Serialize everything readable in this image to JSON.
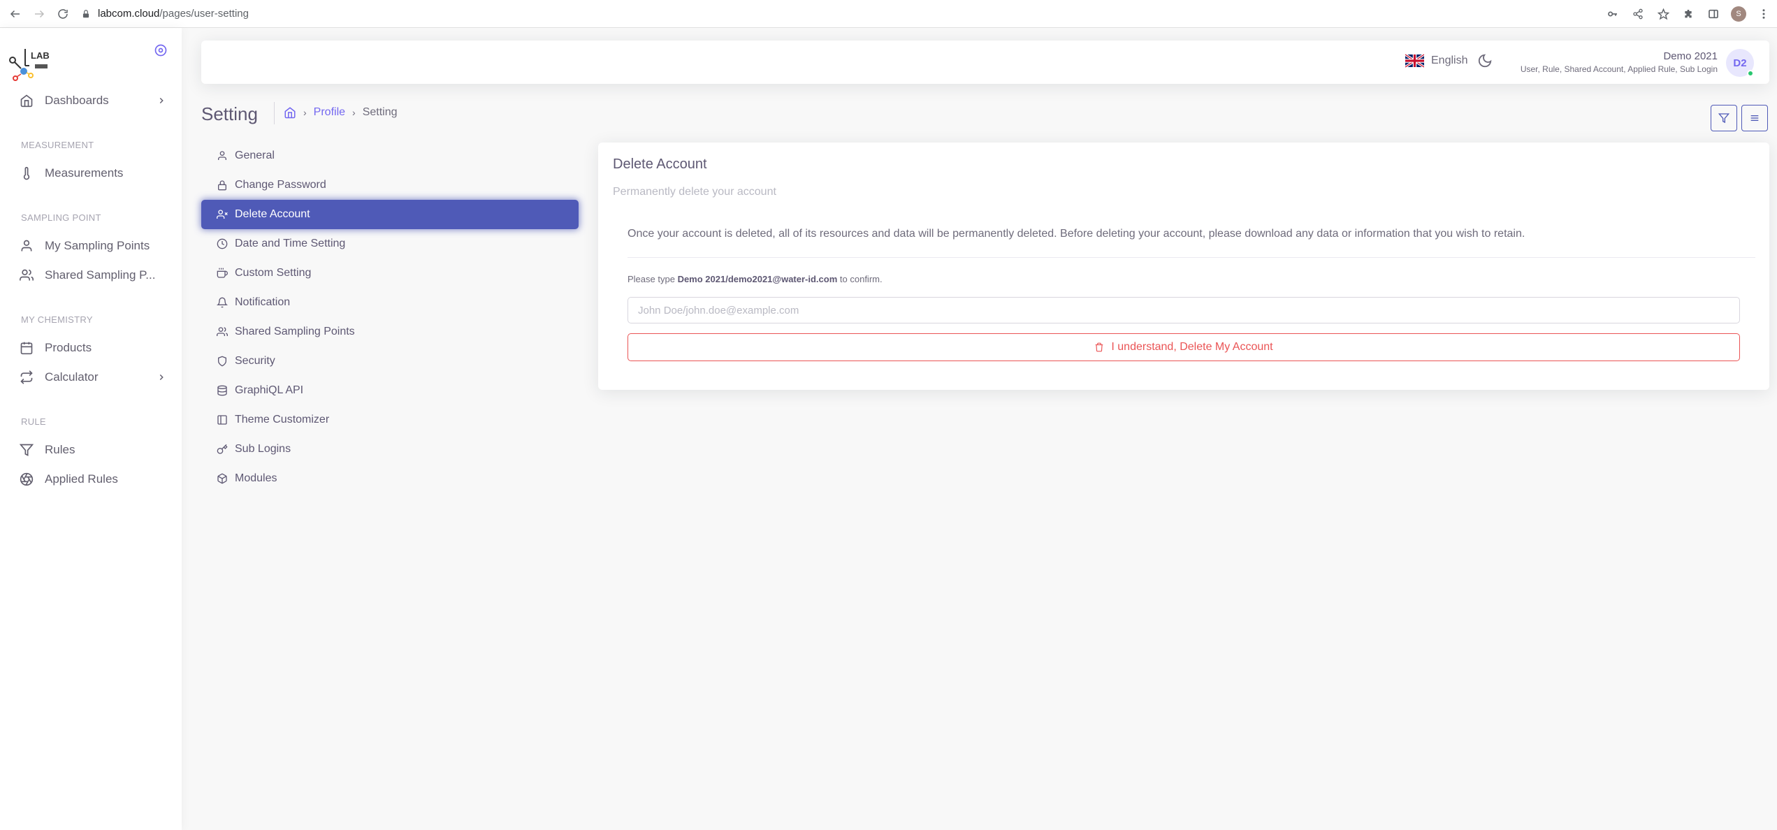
{
  "browser": {
    "url_host": "labcom.cloud",
    "url_path": "/pages/user-setting",
    "profile_initial": "S"
  },
  "sidebar": {
    "logo_text": "LAB",
    "items": [
      {
        "label": "Dashboards",
        "icon": "home-icon",
        "has_chevron": true
      },
      {
        "header": "MEASUREMENT"
      },
      {
        "label": "Measurements",
        "icon": "thermometer-icon"
      },
      {
        "header": "SAMPLING POINT"
      },
      {
        "label": "My Sampling Points",
        "icon": "user-icon"
      },
      {
        "label": "Shared Sampling P...",
        "icon": "users-icon"
      },
      {
        "header": "MY CHEMISTRY"
      },
      {
        "label": "Products",
        "icon": "calendar-icon"
      },
      {
        "label": "Calculator",
        "icon": "repeat-icon",
        "has_chevron": true
      },
      {
        "header": "RULE"
      },
      {
        "label": "Rules",
        "icon": "filter-icon"
      },
      {
        "label": "Applied Rules",
        "icon": "aperture-icon"
      }
    ]
  },
  "navbar": {
    "language": "English",
    "user_name": "Demo 2021",
    "user_roles": "User, Rule, Shared Account, Applied Rule, Sub Login",
    "avatar_initials": "D2"
  },
  "page": {
    "title": "Setting",
    "breadcrumb": [
      "Profile",
      "Setting"
    ]
  },
  "settings_menu": [
    {
      "label": "General",
      "icon": "user-icon"
    },
    {
      "label": "Change Password",
      "icon": "lock-icon"
    },
    {
      "label": "Delete Account",
      "icon": "user-x-icon",
      "active": true
    },
    {
      "label": "Date and Time Setting",
      "icon": "clock-icon"
    },
    {
      "label": "Custom Setting",
      "icon": "coffee-icon"
    },
    {
      "label": "Notification",
      "icon": "bell-icon"
    },
    {
      "label": "Shared Sampling Points",
      "icon": "users-icon"
    },
    {
      "label": "Security",
      "icon": "shield-icon"
    },
    {
      "label": "GraphiQL API",
      "icon": "database-icon"
    },
    {
      "label": "Theme Customizer",
      "icon": "layout-icon"
    },
    {
      "label": "Sub Logins",
      "icon": "key-icon"
    },
    {
      "label": "Modules",
      "icon": "box-icon"
    }
  ],
  "card": {
    "title": "Delete Account",
    "subtitle": "Permanently delete your account",
    "description": "Once your account is deleted, all of its resources and data will be permanently deleted. Before deleting your account, please download any data or information that you wish to retain.",
    "confirm_prefix": "Please type",
    "confirm_value": "Demo 2021/demo2021@water-id.com",
    "confirm_suffix": "to confirm.",
    "input_placeholder": "John Doe/john.doe@example.com",
    "input_value": "",
    "delete_button": "I understand, Delete My Account"
  },
  "colors": {
    "primary": "#4f5ab7",
    "danger": "#ea5455",
    "online": "#28c76f"
  }
}
